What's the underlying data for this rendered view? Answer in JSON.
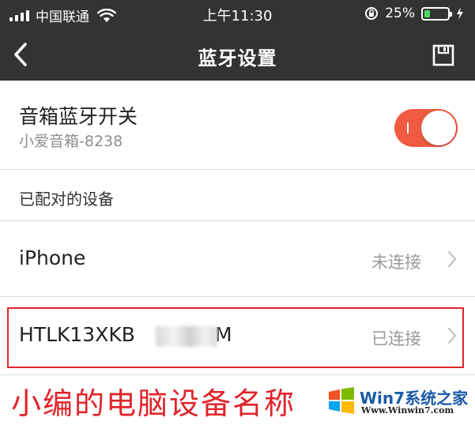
{
  "status_bar": {
    "carrier": "中国联通",
    "time": "上午11:30",
    "battery_percent": "25%",
    "battery_level": 0.25,
    "battery_color": "#4cd964"
  },
  "nav": {
    "title": "蓝牙设置",
    "back_icon": "chevron-left-icon",
    "save_icon": "save-icon",
    "background": "#333333"
  },
  "bluetooth_switch": {
    "label": "音箱蓝牙开关",
    "device_name": "小爱音箱-8238",
    "enabled": true,
    "accent_color": "#ef5a40"
  },
  "paired_section": {
    "label": "已配对的设备",
    "devices": [
      {
        "name": "iPhone",
        "status": "未连接"
      },
      {
        "name_prefix": "HTLK13XKB",
        "name_suffix": "M",
        "status": "已连接",
        "highlighted": true
      }
    ]
  },
  "annotation": {
    "caption": "小编的电脑设备名称",
    "color": "#e0242b"
  },
  "watermark": {
    "brand": "Win7系统之家",
    "url": "Www.Winwin7.com"
  }
}
